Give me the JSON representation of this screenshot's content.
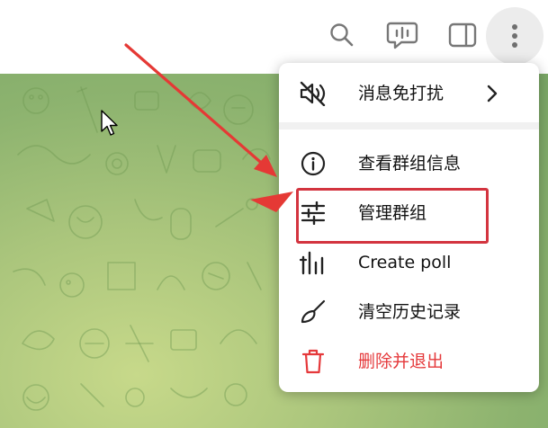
{
  "colors": {
    "menu_text": "#111111",
    "danger": "#e5393b",
    "highlight": "#d3343f",
    "chat_bg_start": "#c7d98a",
    "chat_bg_end": "#7aa766",
    "hover_bg": "#ececec"
  },
  "toolbar": {
    "icons": [
      "search-icon",
      "voice-chat-icon",
      "sidebar-toggle-icon",
      "more-vertical-icon"
    ]
  },
  "menu": {
    "items": [
      {
        "label": "消息免打扰",
        "icon": "mute-icon",
        "has_submenu": true
      },
      {
        "label": "查看群组信息",
        "icon": "info-icon"
      },
      {
        "label": "管理群组",
        "icon": "sliders-icon",
        "highlighted": true
      },
      {
        "label": "Create poll",
        "icon": "poll-icon"
      },
      {
        "label": "清空历史记录",
        "icon": "broom-icon"
      },
      {
        "label": "删除并退出",
        "icon": "trash-icon",
        "danger": true
      }
    ]
  }
}
